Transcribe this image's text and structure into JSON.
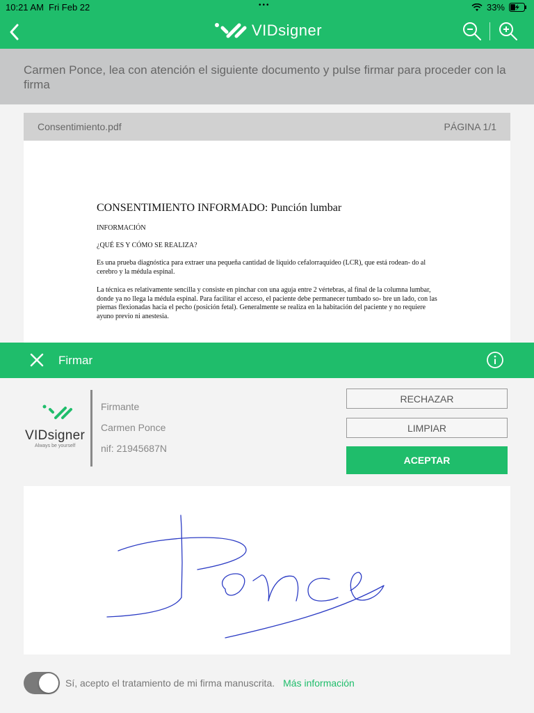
{
  "status": {
    "time": "10:21 AM",
    "date": "Fri Feb 22",
    "battery": "33%"
  },
  "header": {
    "brand": "VIDsigner"
  },
  "instruction": "Carmen Ponce, lea con atención el siguiente documento  y pulse firmar para proceder con la firma",
  "document": {
    "filename": "Consentimiento.pdf",
    "page_label": "PÁGINA  1/1",
    "title": "CONSENTIMIENTO INFORMADO: Punción lumbar",
    "section": "INFORMACIÓN",
    "question": "¿QUÉ ES Y CÓMO SE REALIZA?",
    "paragraph1": "Es una prueba diagnóstica para extraer una pequeña cantidad de líquido cefalorraquídeo (LCR), que está rodean- do al cerebro y la médula espinal.",
    "paragraph2": "La técnica es relativamente sencilla y consiste en pinchar con una aguja entre 2 vértebras, al final de la columna lumbar, donde ya no llega la médula espinal. Para facilitar el acceso, el paciente debe permanecer tumbado so- bre un lado, con las piernas flexionadas hacia el pecho (posición fetal). Generalmente se realiza en la habitación del paciente y no requiere ayuno previo ni anestesia."
  },
  "sign_panel": {
    "title": "Firmar",
    "logo_wordmark": "VIDsigner",
    "logo_tagline": "Always be yourself",
    "signer_label": "Firmante",
    "signer_name": "Carmen Ponce",
    "signer_nif": "nif: 21945687N",
    "reject_label": "RECHAZAR",
    "clear_label": "LIMPIAR",
    "accept_label": "ACEPTAR"
  },
  "consent": {
    "text": "Sí, acepto el tratamiento de mi firma manuscrita.",
    "link": "Más información",
    "toggle_on": true
  },
  "colors": {
    "brand_green": "#1fbd6b",
    "signature_ink": "#2b3bc4"
  }
}
